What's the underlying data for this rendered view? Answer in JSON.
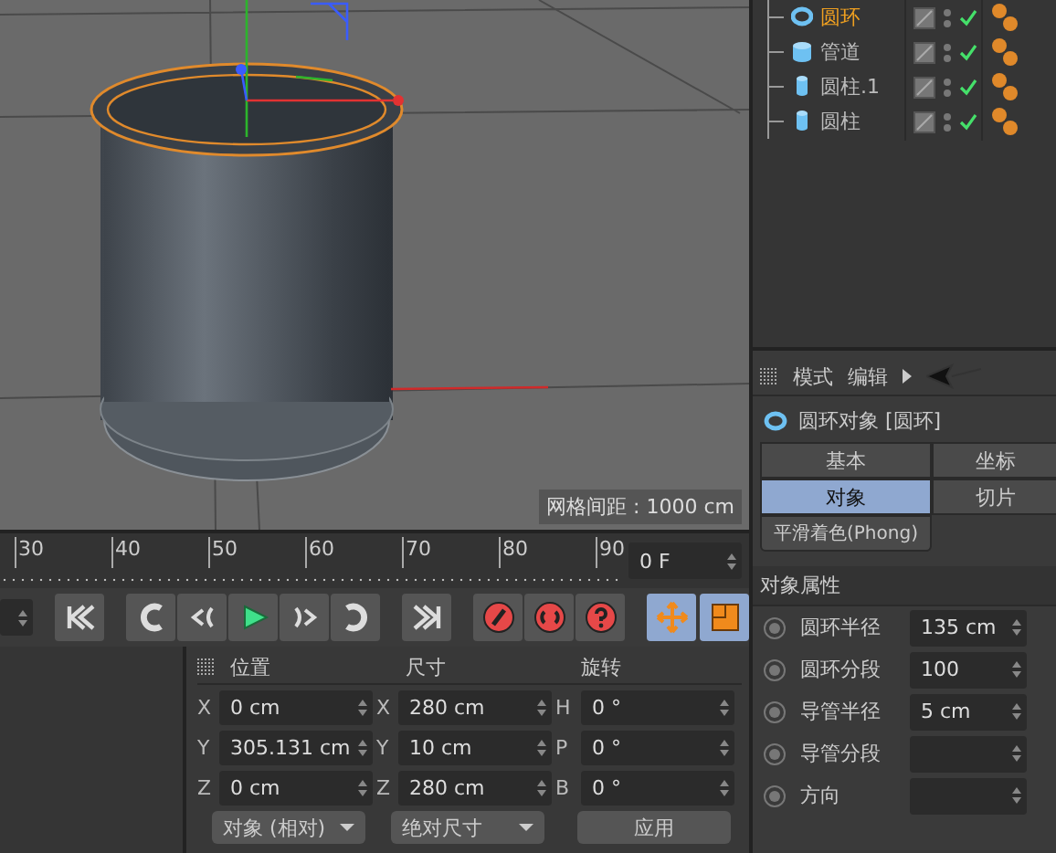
{
  "viewport": {
    "grid_label": "网格间距 : 1000 cm"
  },
  "objects": [
    {
      "name": "圆环",
      "kind": "torus",
      "selected": true
    },
    {
      "name": "管道",
      "kind": "tube",
      "selected": false
    },
    {
      "name": "圆柱.1",
      "kind": "cylinder",
      "selected": false
    },
    {
      "name": "圆柱",
      "kind": "cylinder",
      "selected": false
    }
  ],
  "timeline": {
    "ticks": [
      "30",
      "40",
      "50",
      "60",
      "70",
      "80",
      "90"
    ],
    "frame": "0 F"
  },
  "coordinates": {
    "headers": [
      "位置",
      "尺寸",
      "旋转"
    ],
    "rows": [
      [
        {
          "axis": "X",
          "value": "0 cm"
        },
        {
          "axis": "X",
          "value": "280 cm"
        },
        {
          "axis": "H",
          "value": "0 °"
        }
      ],
      [
        {
          "axis": "Y",
          "value": "305.131 cm"
        },
        {
          "axis": "Y",
          "value": "10 cm"
        },
        {
          "axis": "P",
          "value": "0 °"
        }
      ],
      [
        {
          "axis": "Z",
          "value": "0 cm"
        },
        {
          "axis": "Z",
          "value": "280 cm"
        },
        {
          "axis": "B",
          "value": "0 °"
        }
      ]
    ],
    "dropdowns": [
      "对象 (相对)",
      "绝对尺寸"
    ],
    "apply": "应用"
  },
  "attributes": {
    "menu": [
      "模式",
      "编辑"
    ],
    "title": "圆环对象 [圆环]",
    "tabs": [
      {
        "label": "基本",
        "selected": false
      },
      {
        "label": "坐标",
        "selected": false
      },
      {
        "label": "对象",
        "selected": true
      },
      {
        "label": "切片",
        "selected": false
      },
      {
        "label": "平滑着色(Phong)",
        "selected": false
      }
    ],
    "section": "对象属性",
    "fields": [
      {
        "label": "圆环半径",
        "value": "135 cm"
      },
      {
        "label": "圆环分段",
        "value": "100"
      },
      {
        "label": "导管半径",
        "value": "5 cm"
      },
      {
        "label": "导管分段"
      },
      {
        "label": "方向"
      }
    ]
  }
}
